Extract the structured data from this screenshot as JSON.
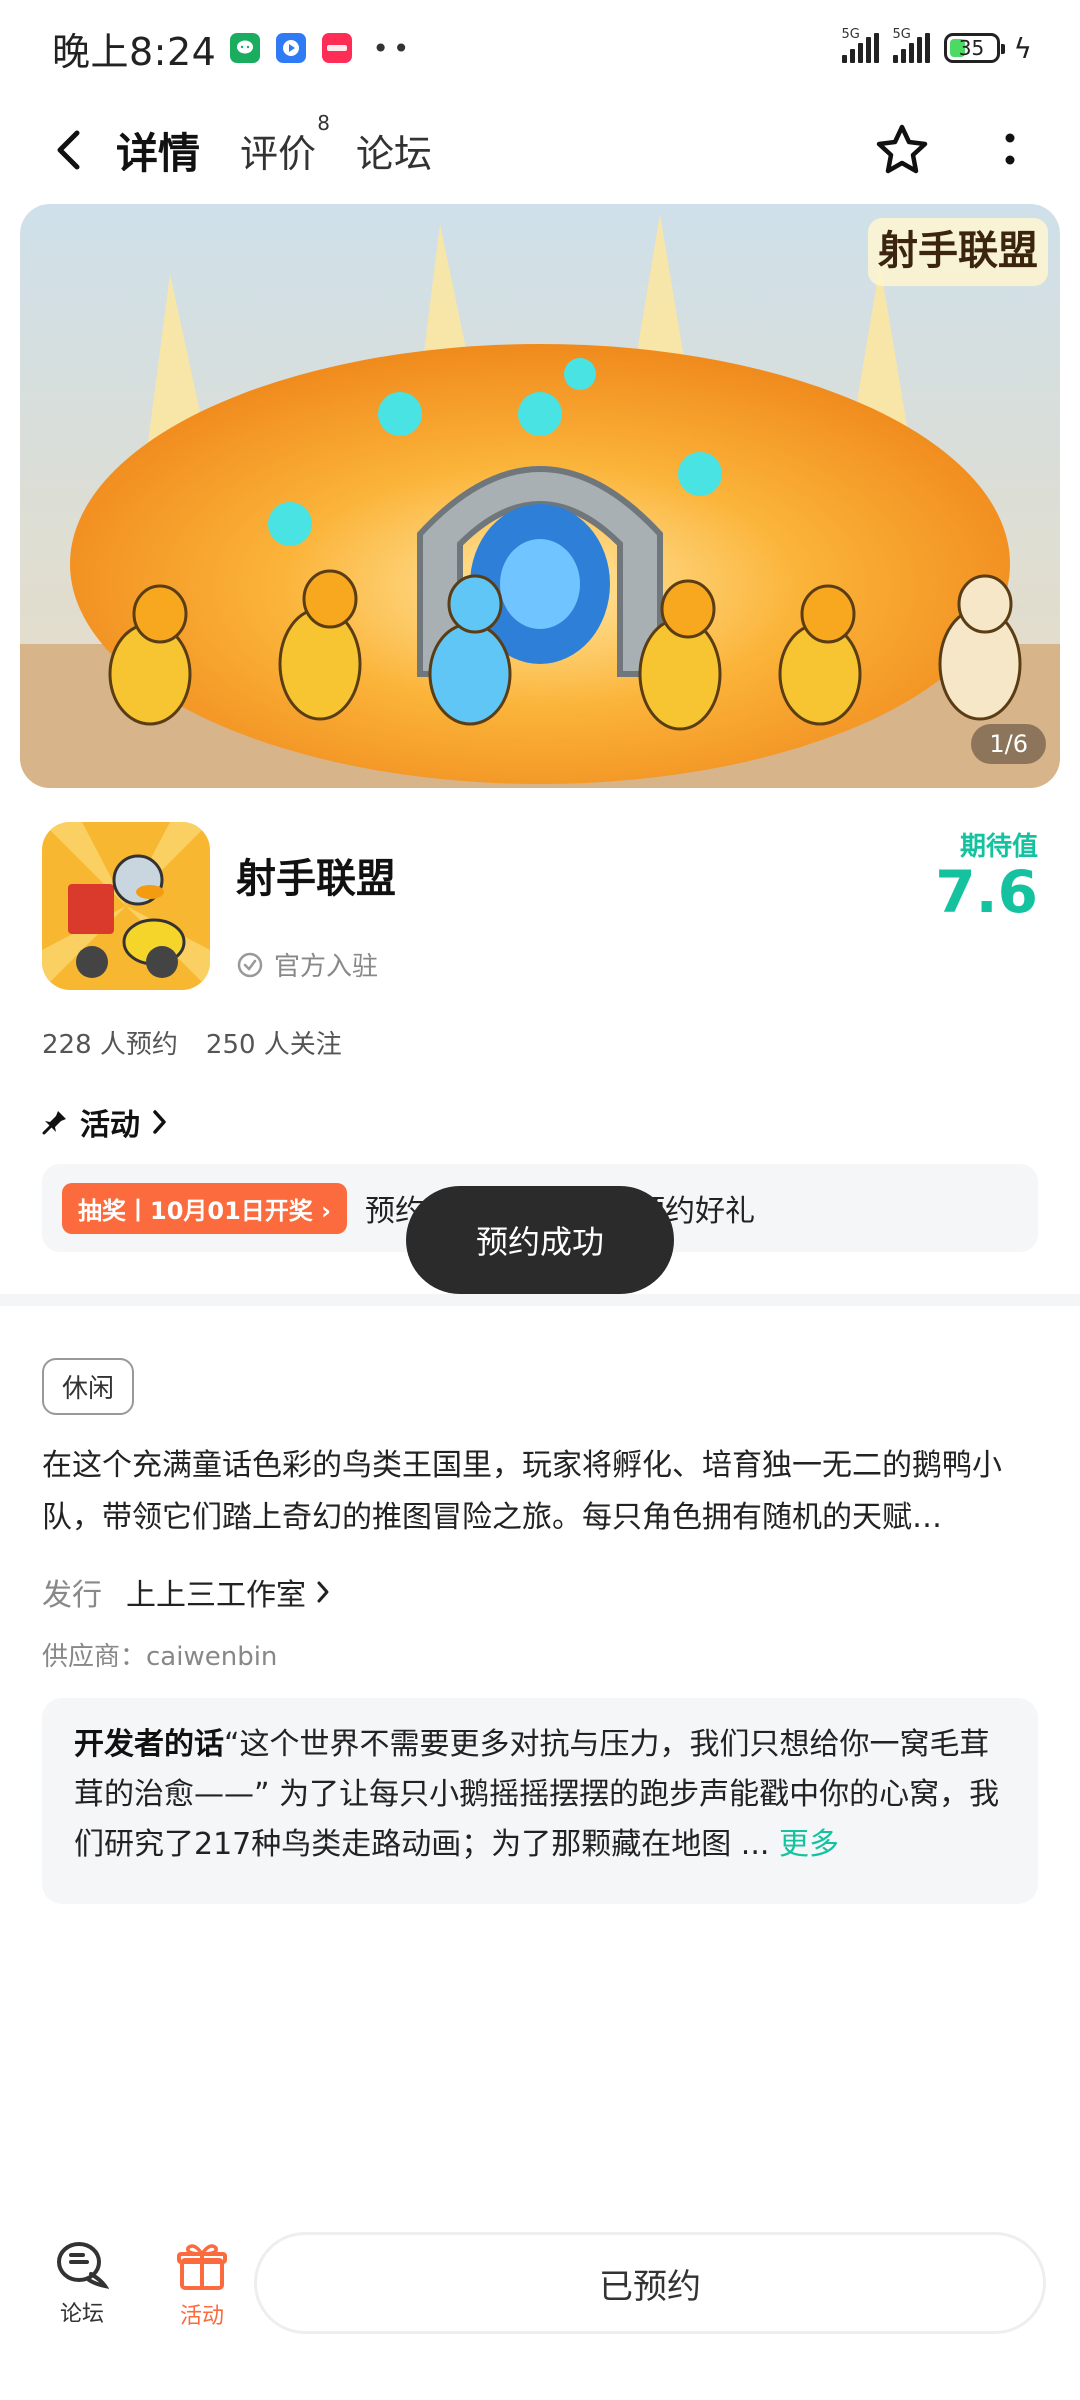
{
  "status_bar": {
    "time": "晚上8:24",
    "signal_label_1": "5G",
    "signal_label_2": "5G",
    "battery": "35",
    "app_icons": [
      "wechat-icon",
      "video-icon",
      "redbook-icon"
    ]
  },
  "nav": {
    "tabs": [
      {
        "label": "详情",
        "active": true
      },
      {
        "label": "评价",
        "badge": "8"
      },
      {
        "label": "论坛"
      }
    ]
  },
  "banner": {
    "title_art": "射手联盟",
    "counter": "1/6"
  },
  "game": {
    "name": "射手联盟",
    "official_label": "官方入驻",
    "expect_label": "期待值",
    "expect_value": "7.6",
    "reservations": "228 人预约",
    "followers": "250 人关注"
  },
  "activity": {
    "header": "活动",
    "tag": "抽奖丨10月01日开奖",
    "text": "预约…【射手联盟】预约好礼"
  },
  "toast": "预约成功",
  "details": {
    "genre": "休闲",
    "description": "在这个充满童话色彩的鸟类王国里，玩家将孵化、培育独一无二的鹅鸭小队，带领它们踏上奇幻的推图冒险之旅。每只角色拥有随机的天赋…",
    "publisher_label": "发行",
    "publisher_value": "上上三工作室",
    "supplier": "供应商：caiwenbin"
  },
  "developer": {
    "label": "开发者的话",
    "text": "“这个世界不需要更多对抗与压力，我们只想给你一窝毛茸茸的治愈——” 为了让每只小鹅摇摇摆摆的跑步声能戳中你的心窝，我们研究了217种鸟类走路动画；为了那颗藏在地图 ...",
    "more": "更多"
  },
  "bottom": {
    "forum_label": "论坛",
    "activity_label": "活动",
    "reserve_button": "已预约"
  },
  "colors": {
    "accent": "#15c2a0",
    "tab_underline": "#1ed1b0",
    "activity_orange": "#fb6b3d"
  }
}
